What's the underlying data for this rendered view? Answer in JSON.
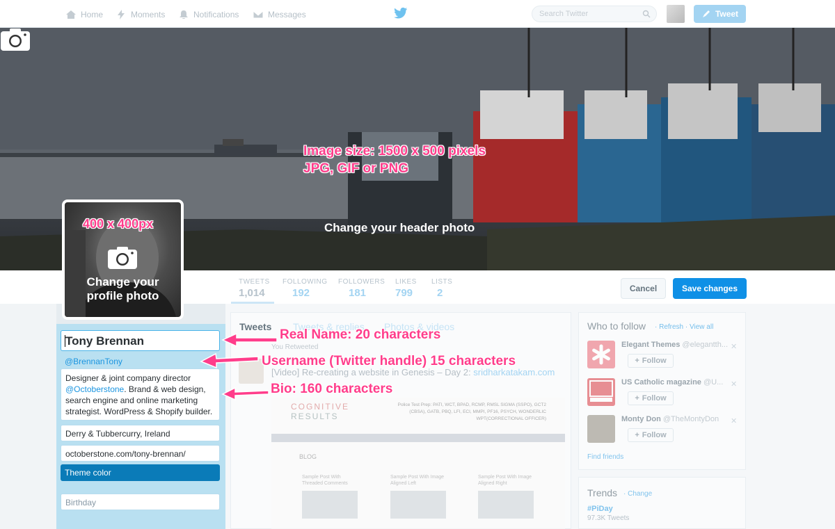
{
  "nav": {
    "home": "Home",
    "moments": "Moments",
    "notifications": "Notifications",
    "messages": "Messages",
    "search_placeholder": "Search Twitter",
    "tweet_button": "Tweet"
  },
  "header_photo": {
    "annotation_line1": "Image size: 1500 x 500 pixels",
    "annotation_line2": "JPG, GIF or PNG",
    "change_label": "Change your header photo"
  },
  "profile_photo": {
    "annotation": "400 x 400px",
    "change_label_line1": "Change your",
    "change_label_line2": "profile photo"
  },
  "stats": [
    {
      "label": "TWEETS",
      "value": "1,014"
    },
    {
      "label": "FOLLOWING",
      "value": "192"
    },
    {
      "label": "FOLLOWERS",
      "value": "181"
    },
    {
      "label": "LIKES",
      "value": "799"
    },
    {
      "label": "LISTS",
      "value": "2"
    }
  ],
  "actions": {
    "cancel": "Cancel",
    "save": "Save changes"
  },
  "edit_form": {
    "name": "Tony Brennan",
    "username": "@BrennanTony",
    "bio_part1": "Designer & joint company director ",
    "bio_mention": "@Octoberstone",
    "bio_part2": ". Brand & web design, search engine and online marketing strategist. WordPress & Shopify builder.",
    "location": "Derry & Tubbercurry, Ireland",
    "website": "octoberstone.com/tony-brennan/",
    "theme_color": "Theme color",
    "birthday": "Birthday"
  },
  "annotations": {
    "name": "Real Name: 20 characters",
    "username": "Username (Twitter handle) 15 characters",
    "bio": "Bio: 160 characters"
  },
  "timeline": {
    "tabs": [
      "Tweets",
      "Tweets & replies",
      "Photos & videos"
    ],
    "retweet_note": "You Retweeted",
    "tweet_text": "[Video] Re-creating a website in Genesis – Day 2: ",
    "tweet_link": "sridharkatakam.com",
    "embed": {
      "brand_line1": "COGNITIVE",
      "brand_line2": "RESULTS",
      "police_text": "Police Test Prep: PATI, WCT, BPAD, RCMP, RMSL SIGMA (SSPO), GCT2 (CBSA), GATB, PBQ, LFI, ECI, MMPI, PF16, PSYCH, WONDERLIC WPT(CORRECTIONAL OFFICER)",
      "blog": "BLOG",
      "posts": [
        "Sample Post With Threaded Comments",
        "Sample Post With Image Aligned Left",
        "Sample Post With Image Aligned Right"
      ]
    }
  },
  "who_to_follow": {
    "title": "Who to follow",
    "refresh": "· Refresh",
    "view_all": "· View all",
    "follow_label": "Follow",
    "find_friends": "Find friends",
    "items": [
      {
        "name": "Elegant Themes",
        "handle": "@elegantth..."
      },
      {
        "name": "US Catholic magazine",
        "handle": "@U..."
      },
      {
        "name": "Monty Don",
        "handle": "@TheMontyDon"
      }
    ]
  },
  "trends": {
    "title": "Trends",
    "change": "· Change",
    "items": [
      {
        "tag": "#PiDay",
        "count": "97.3K Tweets"
      }
    ]
  },
  "colors": {
    "accent": "#1b95e0",
    "save_button": "#0f90e6",
    "annotation": "#ff3d8b",
    "theme_color": "#0a7bb8"
  }
}
